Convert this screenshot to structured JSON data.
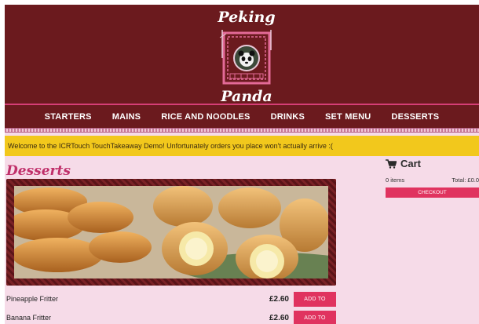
{
  "brand": {
    "name_top": "Peking",
    "name_bottom": "Panda"
  },
  "nav": {
    "items": [
      {
        "label": "STARTERS"
      },
      {
        "label": "MAINS"
      },
      {
        "label": "RICE AND NOODLES"
      },
      {
        "label": "DRINKS"
      },
      {
        "label": "SET MENU"
      },
      {
        "label": "DESSERTS"
      }
    ]
  },
  "banner": {
    "text": "Welcome to the ICRTouch TouchTakeaway Demo! Unfortunately orders you place won't actually arrive :("
  },
  "section": {
    "title": "Desserts"
  },
  "items": [
    {
      "name": "Pineapple Fritter",
      "price": "£2.60",
      "button": "ADD TO ORDER"
    },
    {
      "name": "Banana Fritter",
      "price": "£2.60",
      "button": "ADD TO ORDER"
    }
  ],
  "cart": {
    "title": "Cart",
    "count_text": "0 items",
    "total_text": "Total: £0.0",
    "checkout_label": "CHECKOUT",
    "icon": "cart-icon"
  },
  "colors": {
    "header_bg": "#6b1a1e",
    "accent_pink": "#e0335f",
    "page_bg": "#f6dbe8",
    "banner_bg": "#f2c81c",
    "title_color": "#c0306a"
  }
}
